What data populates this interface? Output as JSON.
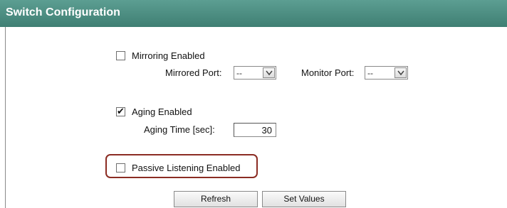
{
  "header": {
    "title": "Switch Configuration"
  },
  "mirroring": {
    "label": "Mirroring Enabled",
    "checked": false,
    "mirrored_port_label": "Mirrored Port:",
    "mirrored_port_value": "--",
    "monitor_port_label": "Monitor Port:",
    "monitor_port_value": "--"
  },
  "aging": {
    "label": "Aging Enabled",
    "checked": true,
    "check_mark": "✔",
    "time_label": "Aging Time [sec]:",
    "time_value": "30"
  },
  "passive": {
    "label": "Passive Listening Enabled",
    "checked": false
  },
  "buttons": {
    "refresh_label": "Refresh",
    "set_values_label": "Set Values"
  },
  "colors": {
    "header_bg": "#4a8a7e",
    "highlight_border": "#8b2c23"
  }
}
